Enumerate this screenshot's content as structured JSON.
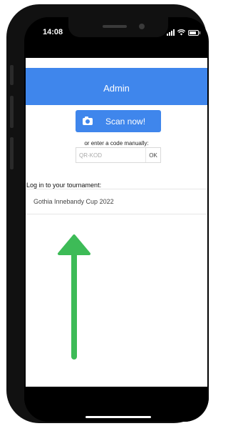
{
  "status_bar": {
    "time": "14:08",
    "icons": [
      "signal-icon",
      "wifi-icon",
      "battery-icon"
    ]
  },
  "header": {
    "title": "Admin"
  },
  "scan": {
    "button_label": "Scan now!",
    "icon": "camera-icon"
  },
  "manual_code": {
    "hint": "or enter a code manually:",
    "placeholder": "QR-KOD",
    "value": "",
    "ok_label": "OK"
  },
  "login": {
    "label": "Log in to your tournament:",
    "tournaments": [
      {
        "name": "Gothia Innebandy Cup 2022"
      }
    ]
  },
  "colors": {
    "accent": "#3f86ec",
    "arrow": "#3dbb57",
    "background": "#ffffff"
  }
}
